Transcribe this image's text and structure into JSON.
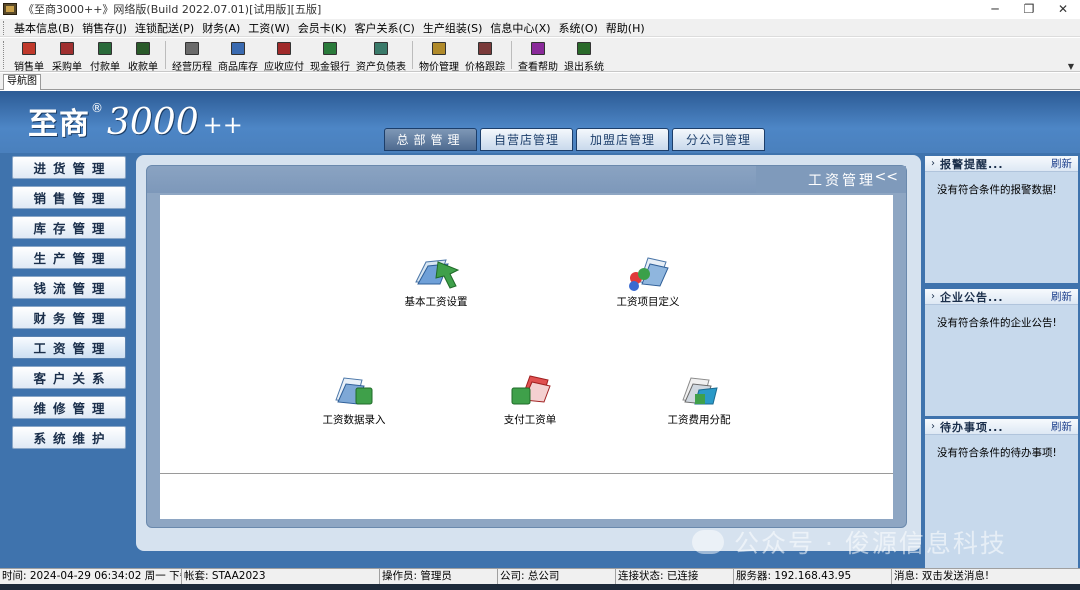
{
  "window": {
    "title": "《至商3000++》网络版(Build 2022.07.01)[试用版][五版]",
    "minimize": "─",
    "maximize": "❐",
    "close": "✕"
  },
  "menu": [
    "基本信息(B)",
    "销售存(J)",
    "连锁配送(P)",
    "财务(A)",
    "工资(W)",
    "会员卡(K)",
    "客户关系(C)",
    "生产组装(S)",
    "信息中心(X)",
    "系统(O)",
    "帮助(H)"
  ],
  "toolbar": {
    "group1": [
      {
        "label": "销售单",
        "icon": "sales-doc-icon",
        "color": "#c0392b"
      },
      {
        "label": "采购单",
        "icon": "purchase-doc-icon",
        "color": "#a03030"
      },
      {
        "label": "付款单",
        "icon": "payment-doc-icon",
        "color": "#2a6a3a"
      },
      {
        "label": "收款单",
        "icon": "receipt-doc-icon",
        "color": "#2a5a2a"
      }
    ],
    "group2": [
      {
        "label": "经营历程",
        "icon": "history-icon",
        "color": "#6a6a6a"
      },
      {
        "label": "商品库存",
        "icon": "inventory-icon",
        "color": "#3a6ab0"
      },
      {
        "label": "应收应付",
        "icon": "receivable-icon",
        "color": "#a02a2a"
      },
      {
        "label": "现金银行",
        "icon": "cash-bank-icon",
        "color": "#2a7a3a"
      },
      {
        "label": "资产负债表",
        "icon": "balance-sheet-icon",
        "color": "#3a7a6a"
      }
    ],
    "group3": [
      {
        "label": "物价管理",
        "icon": "price-manage-icon",
        "color": "#b08a2a"
      },
      {
        "label": "价格跟踪",
        "icon": "price-track-icon",
        "color": "#7a3a3a"
      }
    ],
    "group4": [
      {
        "label": "查看帮助",
        "icon": "help-book-icon",
        "color": "#8a2a9a"
      },
      {
        "label": "退出系统",
        "icon": "exit-icon",
        "color": "#2a6a2a"
      }
    ]
  },
  "nav_tab": "导航图",
  "logo": {
    "cn": "至商",
    "reg": "®",
    "num": "3000",
    "plus": "++"
  },
  "top_tabs": [
    {
      "label": "总部管理",
      "active": true
    },
    {
      "label": "自营店管理",
      "active": false
    },
    {
      "label": "加盟店管理",
      "active": false
    },
    {
      "label": "分公司管理",
      "active": false
    }
  ],
  "left_nav": [
    {
      "label": "进货管理",
      "active": false
    },
    {
      "label": "销售管理",
      "active": false
    },
    {
      "label": "库存管理",
      "active": false
    },
    {
      "label": "生产管理",
      "active": false
    },
    {
      "label": "钱流管理",
      "active": false
    },
    {
      "label": "财务管理",
      "active": false
    },
    {
      "label": "工资管理",
      "active": true
    },
    {
      "label": "客户关系",
      "active": false
    },
    {
      "label": "维修管理",
      "active": false
    },
    {
      "label": "系统维护",
      "active": false
    }
  ],
  "panel": {
    "title": "工资管理",
    "collapse": "<<",
    "functions": [
      {
        "label": "基本工资设置",
        "icon": "basic-salary-setting-icon"
      },
      {
        "label": "工资项目定义",
        "icon": "salary-item-definition-icon"
      },
      {
        "label": "工资数据录入",
        "icon": "salary-data-entry-icon"
      },
      {
        "label": "支付工资单",
        "icon": "pay-salary-icon"
      },
      {
        "label": "工资费用分配",
        "icon": "salary-expense-allocation-icon"
      }
    ]
  },
  "right_panels": [
    {
      "title": "报警提醒...",
      "refresh": "刷新",
      "message": "没有符合条件的报警数据!"
    },
    {
      "title": "企业公告...",
      "refresh": "刷新",
      "message": "没有符合条件的企业公告!"
    },
    {
      "title": "待办事项...",
      "refresh": "刷新",
      "message": "没有符合条件的待办事项!"
    }
  ],
  "watermark": "公众号 · 俊源信息科技",
  "status": {
    "time": "时间: 2024-04-29 06:34:02 周一 下午",
    "account": "帐套: STAA2023",
    "operator": "操作员: 管理员",
    "company": "公司: 总公司",
    "connection": "连接状态: 已连接",
    "server": "服务器: 192.168.43.95",
    "message": "消息: 双击发送消息!"
  }
}
